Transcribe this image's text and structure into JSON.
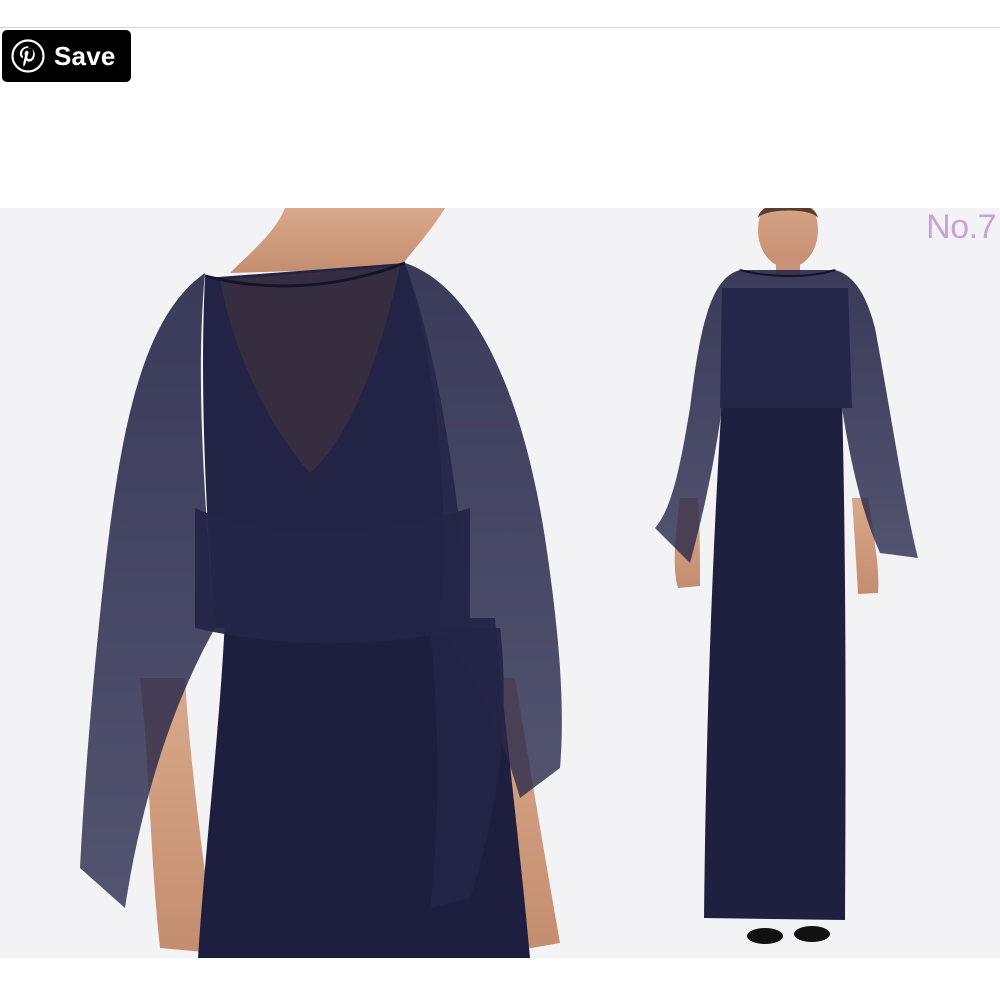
{
  "pin_button": {
    "label": "Save",
    "icon": "pinterest-icon"
  },
  "collage": {
    "number_label": "No.7"
  },
  "colors": {
    "button_bg": "#000000",
    "button_text": "#ffffff",
    "number_label": "#c9a2dc",
    "dress_navy": "#1f2040",
    "photo_bg": "#f3f3f5"
  }
}
